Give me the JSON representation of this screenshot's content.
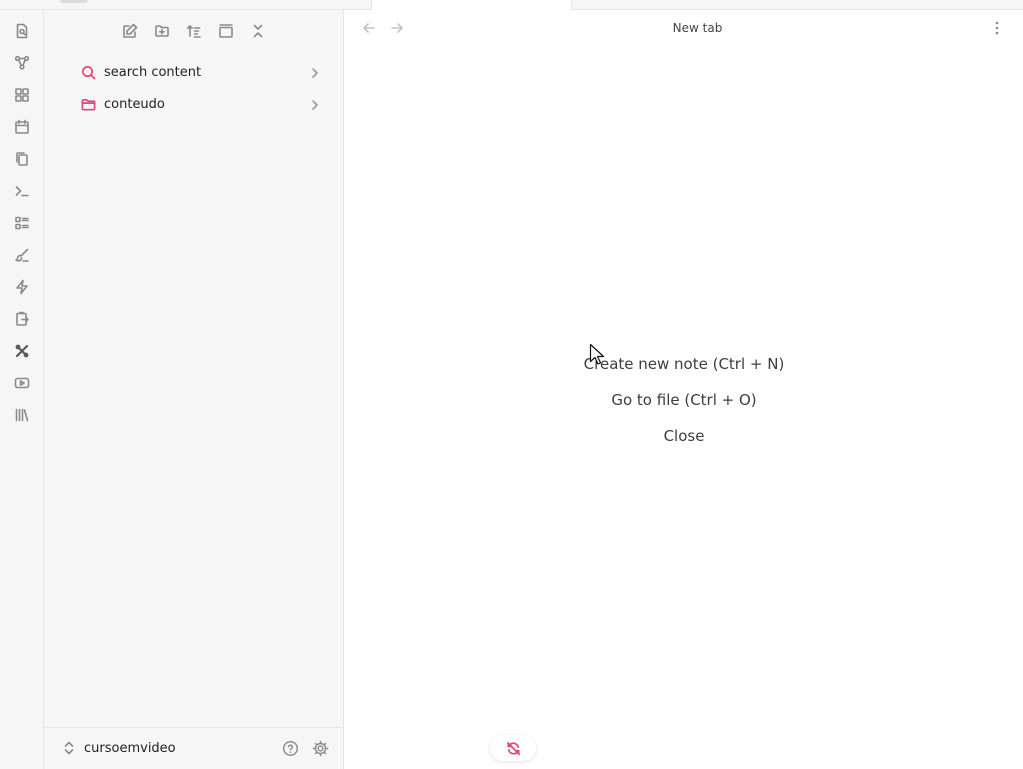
{
  "colors": {
    "accent": "#e0467c",
    "icon_gray": "#8a8a8a",
    "sidebar_bg": "#f6f6f6",
    "border": "#e6e6e6"
  },
  "ribbon": {
    "items": [
      {
        "icon": "file-search-icon"
      },
      {
        "icon": "graph-icon"
      },
      {
        "icon": "blocks-icon"
      },
      {
        "icon": "calendar-icon"
      },
      {
        "icon": "copy-icon"
      },
      {
        "icon": "terminal-icon"
      },
      {
        "icon": "list-layout-icon"
      },
      {
        "icon": "brush-icon"
      },
      {
        "icon": "lightning-icon"
      },
      {
        "icon": "clipboard-arrow-icon"
      },
      {
        "icon": "plugin-active-icon"
      },
      {
        "icon": "youtube-icon"
      },
      {
        "icon": "library-icon"
      }
    ]
  },
  "nav_buttons": [
    {
      "icon": "new-note-icon"
    },
    {
      "icon": "new-folder-icon"
    },
    {
      "icon": "sort-icon"
    },
    {
      "icon": "auto-reveal-icon"
    },
    {
      "icon": "collapse-all-icon"
    }
  ],
  "tree": {
    "items": [
      {
        "label": "search content",
        "icon": "search-icon"
      },
      {
        "label": "conteudo",
        "icon": "folder-icon"
      }
    ]
  },
  "vault": {
    "name": "cursoemvideo",
    "help_icon": "help-icon",
    "settings_icon": "settings-icon"
  },
  "header": {
    "title": "New tab"
  },
  "empty_state": {
    "actions": [
      "Create new note (Ctrl + N)",
      "Go to file (Ctrl + O)",
      "Close"
    ]
  },
  "status": {
    "sync_icon": "sync-off-icon"
  }
}
